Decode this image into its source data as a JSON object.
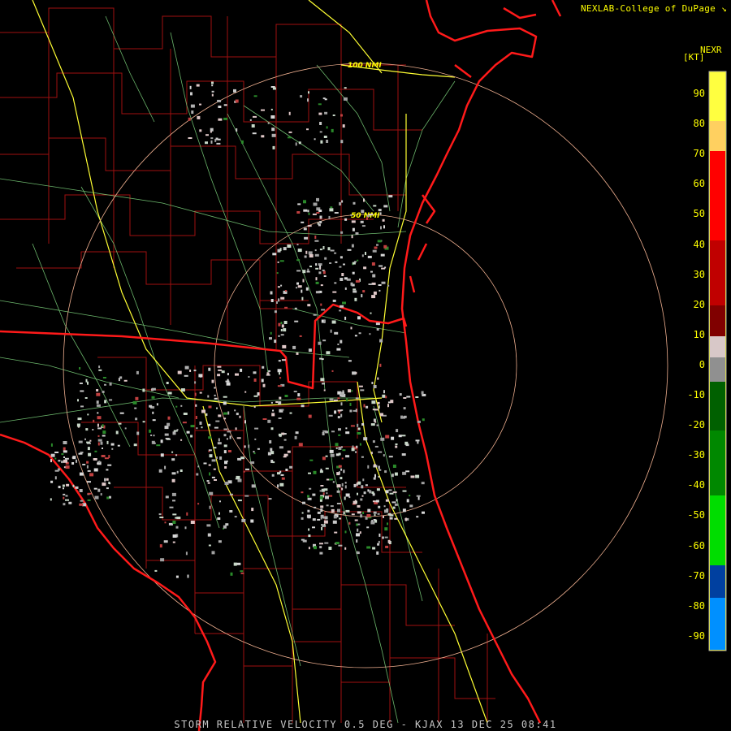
{
  "header": {
    "credit": "NEXLAB-College of DuPage"
  },
  "legend": {
    "product": "NEXR",
    "units": "[KT]",
    "ticks": [
      "90",
      "80",
      "70",
      "60",
      "50",
      "40",
      "30",
      "20",
      "10",
      "0",
      "-10",
      "-20",
      "-30",
      "-40",
      "-50",
      "-60",
      "-70",
      "-80",
      "-90"
    ]
  },
  "range_rings": [
    {
      "label": "100 NMI",
      "range_nmi": 100
    },
    {
      "label": "50 NMI",
      "range_nmi": 50
    }
  ],
  "caption": "STORM RELATIVE VELOCITY 0.5 DEG - KJAX 13 DEC 25 08:41",
  "colors": {
    "background": "#000000",
    "coastline": "#ff1a1a",
    "county": "#b01010",
    "interstate": "#ffff00",
    "highway": "#7fd77f",
    "ring": "#f0b090",
    "text": "#ffff00",
    "caption": "#c8c8c8"
  },
  "icons": {
    "credit-logo": "nexlab-mark-icon"
  }
}
